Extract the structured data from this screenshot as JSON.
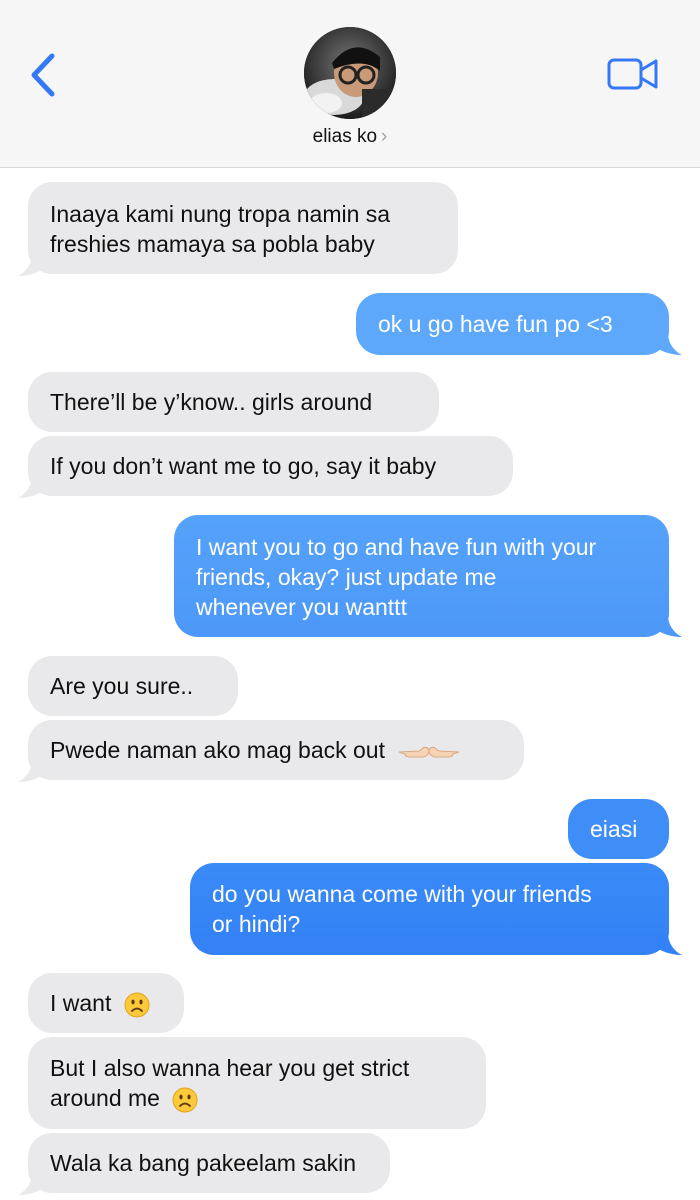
{
  "header": {
    "contact_name": "elias ko",
    "chevron": "›",
    "icons": {
      "back": "chevron-left-icon",
      "video": "video-camera-icon"
    },
    "accent": "#3478f6"
  },
  "colors": {
    "incoming_bubble": "#e9e9eb",
    "outgoing_bubble_top": "#5fa9fb",
    "outgoing_bubble_bottom": "#2f7cf6",
    "outgoing_text": "#ffffff",
    "incoming_text": "#111111"
  },
  "messages": [
    {
      "direction": "in",
      "lines": [
        "Inaaya kami nung tropa namin sa",
        "freshies mamaya sa pobla baby"
      ]
    },
    {
      "direction": "out",
      "lines": [
        "ok u go have fun po <3"
      ]
    },
    {
      "direction": "in",
      "lines": [
        "There’ll be y’know.. girls around"
      ]
    },
    {
      "direction": "in",
      "lines": [
        "If you don’t want me to go, say it baby"
      ]
    },
    {
      "direction": "out",
      "lines": [
        "I want you to go and have fun with your",
        "friends, okay? just update me",
        "whenever you wanttt"
      ]
    },
    {
      "direction": "in",
      "lines": [
        "Are you sure.."
      ]
    },
    {
      "direction": "in",
      "lines": [
        "Pwede naman ako mag back out"
      ],
      "emoji": "pointing-fingers-together"
    },
    {
      "direction": "out",
      "lines": [
        "eiasi"
      ]
    },
    {
      "direction": "out",
      "lines": [
        "do you wanna come with your friends",
        "or hindi?"
      ]
    },
    {
      "direction": "in",
      "lines": [
        "I want"
      ],
      "emoji": "frowning-face"
    },
    {
      "direction": "in",
      "lines": [
        "But I also wanna hear you get strict",
        "around me"
      ],
      "emoji": "frowning-face"
    },
    {
      "direction": "in",
      "lines": [
        "Wala ka bang pakeelam sakin"
      ]
    }
  ]
}
